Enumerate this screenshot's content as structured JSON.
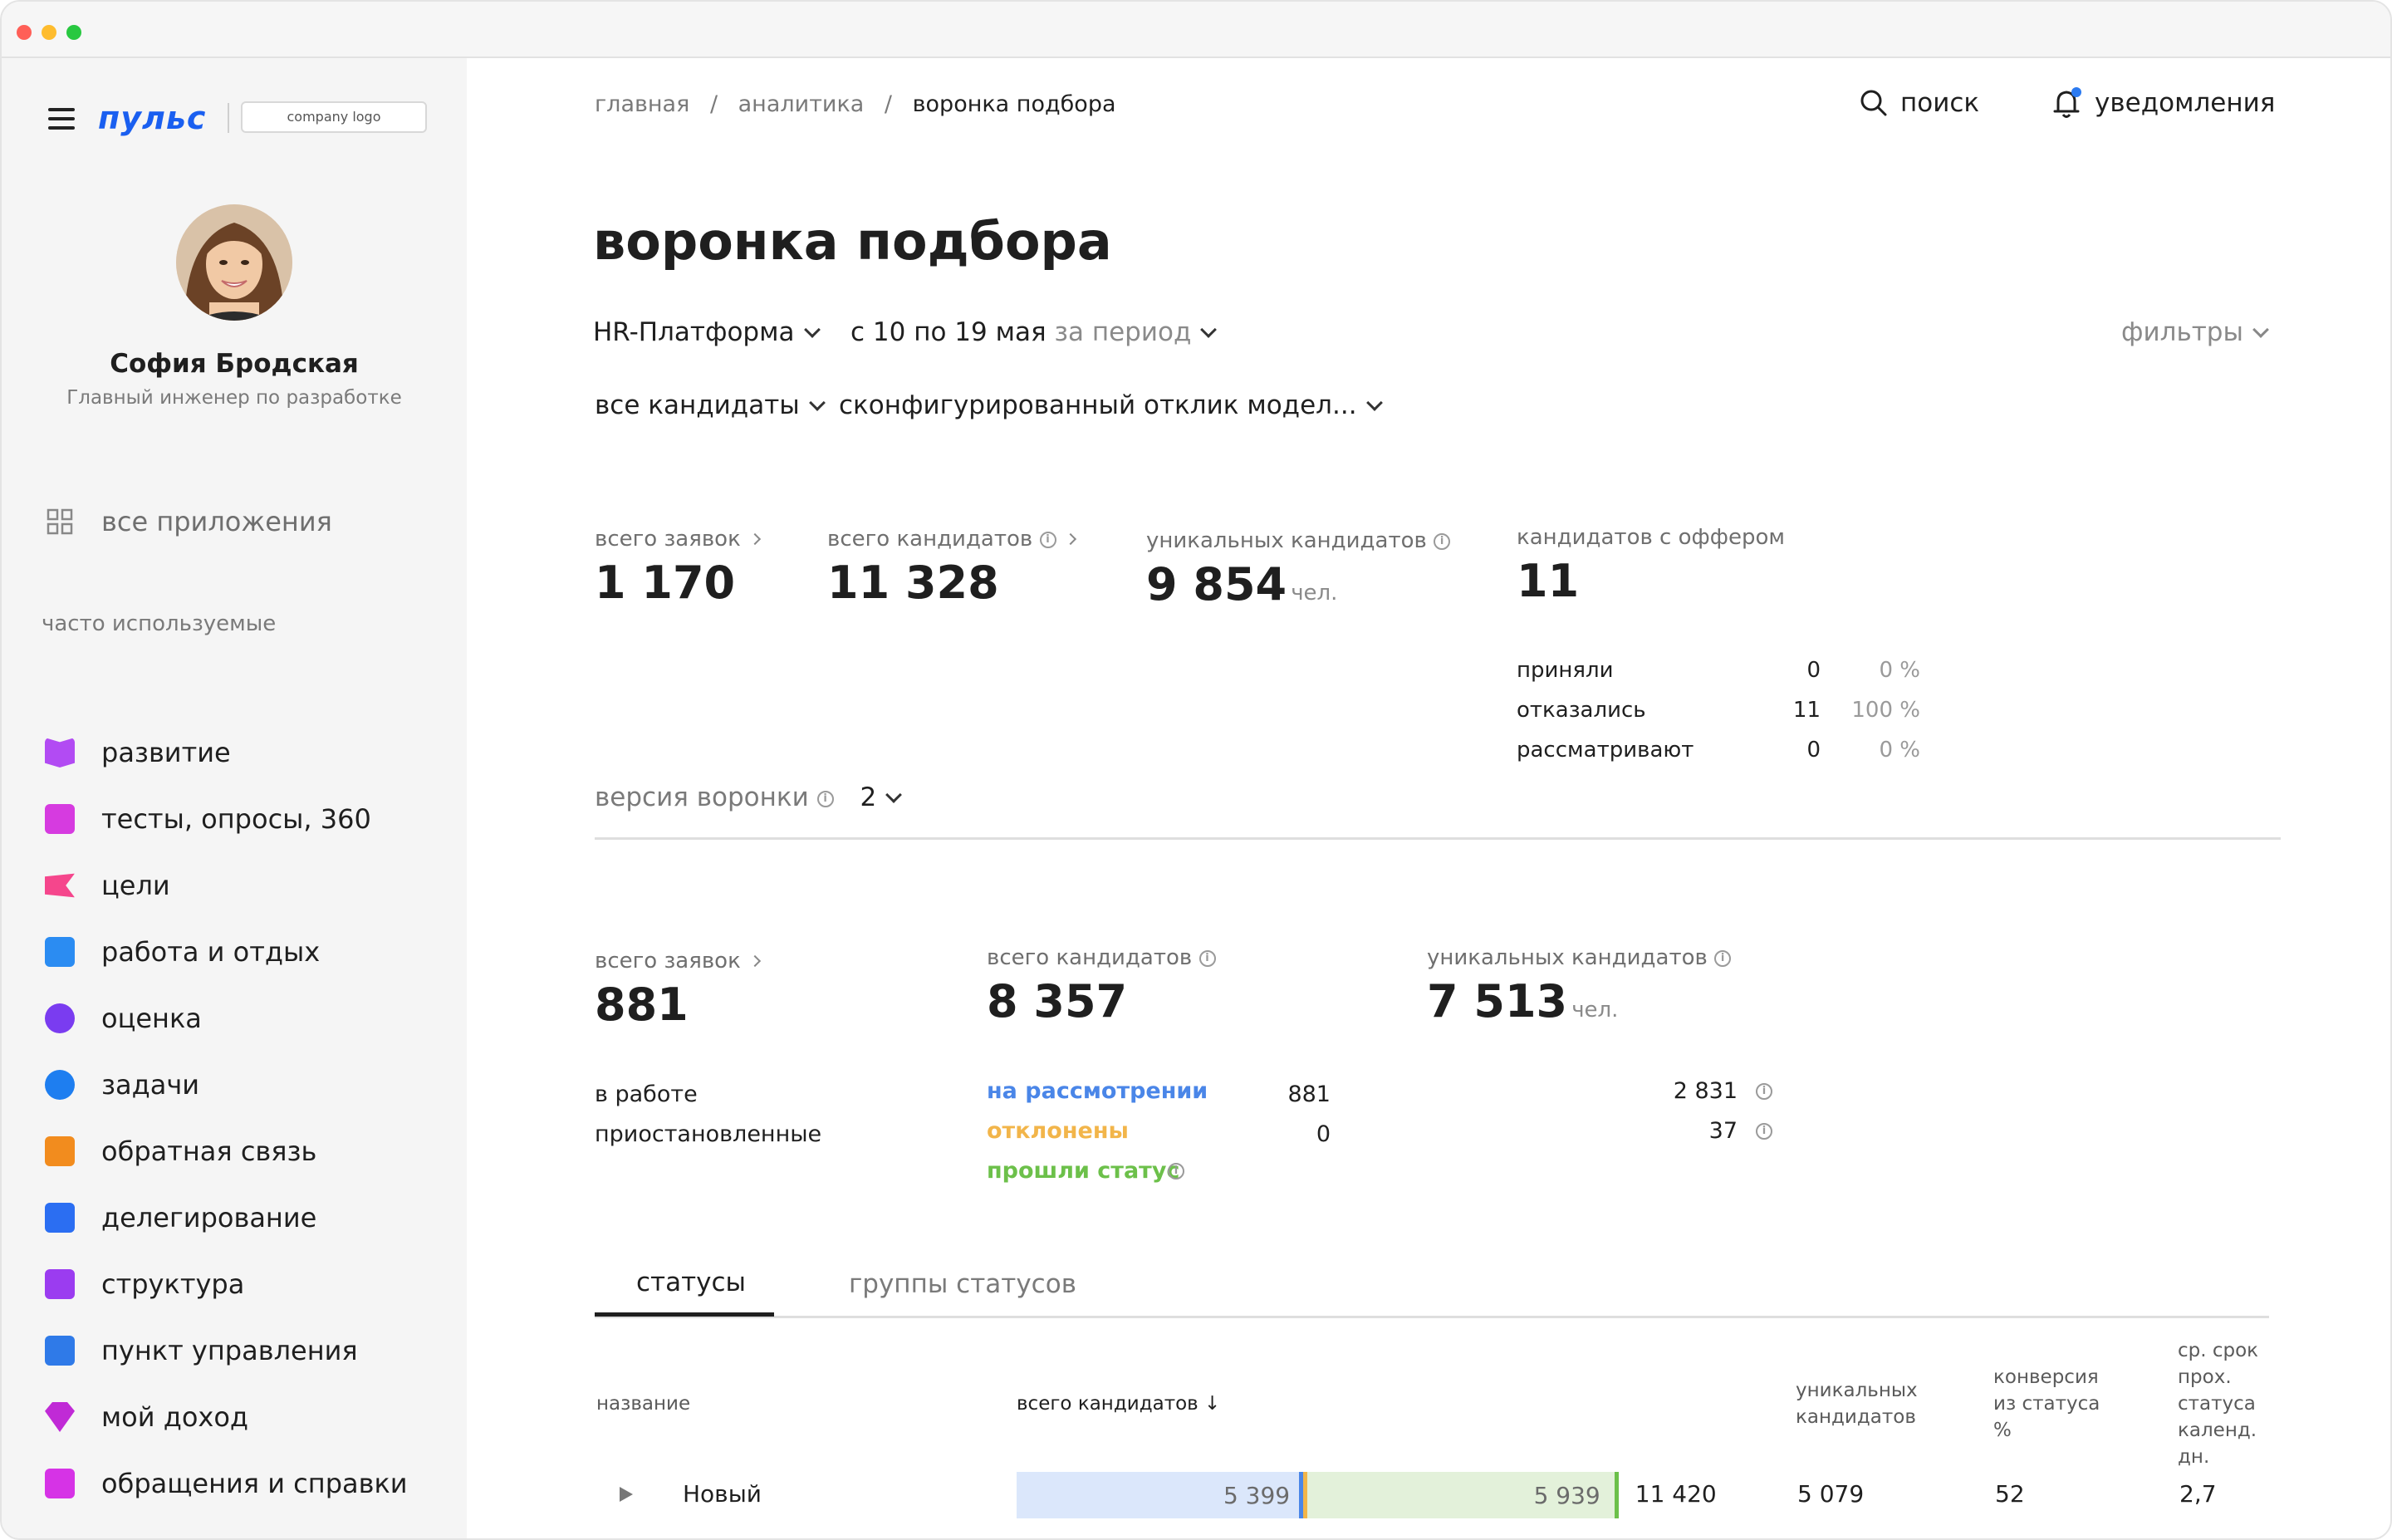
{
  "window": {
    "dots": [
      "#ff5f57",
      "#febc2e",
      "#28c840"
    ]
  },
  "sidebar": {
    "brand": "пульс",
    "company_logo": "company logo",
    "user": {
      "name": "София Бродская",
      "role": "Главный инженер по разработке"
    },
    "all_apps": "все приложения",
    "section_title": "часто используемые",
    "items": [
      {
        "label": "развитие",
        "icon": "book-icon",
        "color": "#b24bf3"
      },
      {
        "label": "тесты, опросы, 360",
        "icon": "checkbox-icon",
        "color": "#d63be0"
      },
      {
        "label": "цели",
        "icon": "flag-icon",
        "color": "#f5468c"
      },
      {
        "label": "работа и отдых",
        "icon": "weather-icon",
        "color": "#2b8cf2"
      },
      {
        "label": "оценка",
        "icon": "star-icon",
        "color": "#7a3cf0"
      },
      {
        "label": "задачи",
        "icon": "target-icon",
        "color": "#1e7ef0"
      },
      {
        "label": "обратная связь",
        "icon": "feedback-icon",
        "color": "#f28c1e"
      },
      {
        "label": "делегирование",
        "icon": "people-icon",
        "color": "#2b6ef2"
      },
      {
        "label": "структура",
        "icon": "structure-icon",
        "color": "#9b3cf0"
      },
      {
        "label": "пункт управления",
        "icon": "wrench-icon",
        "color": "#2f7ae8"
      },
      {
        "label": "мой доход",
        "icon": "gem-icon",
        "color": "#c02ad6"
      },
      {
        "label": "обращения и справки",
        "icon": "document-icon",
        "color": "#d633e6"
      }
    ]
  },
  "header": {
    "breadcrumb": [
      "главная",
      "аналитика",
      "воронка подбора"
    ],
    "search": "поиск",
    "notifications": "уведомления"
  },
  "page": {
    "title": "воронка подбора",
    "platform": "HR-Платформа",
    "period_prefix": "с 10 по 19 мая",
    "period_suffix": "за период",
    "filters": "фильтры",
    "candidates_filter": "все кандидаты",
    "response_filter": "сконфигурированный отклик модел..."
  },
  "summary": {
    "applications": {
      "label": "всего заявок",
      "value": "1 170"
    },
    "candidates": {
      "label": "всего кандидатов",
      "value": "11 328"
    },
    "unique": {
      "label": "уникальных кандидатов",
      "value": "9 854",
      "unit": "чел."
    },
    "offer": {
      "label": "кандидатов с оффером",
      "value": "11",
      "rows": [
        {
          "label": "приняли",
          "count": "0",
          "pct": "0 %"
        },
        {
          "label": "отказались",
          "count": "11",
          "pct": "100 %"
        },
        {
          "label": "рассматривают",
          "count": "0",
          "pct": "0 %"
        }
      ]
    }
  },
  "funnel": {
    "version_label": "версия воронки",
    "version_value": "2",
    "applications": {
      "label": "всего заявок",
      "value": "881",
      "rows": [
        {
          "label": "в работе",
          "value": "881"
        },
        {
          "label": "приостановленные",
          "value": "0"
        }
      ]
    },
    "candidates": {
      "label": "всего кандидатов",
      "value": "8 357",
      "rows": [
        {
          "label": "на рассмотрении",
          "value": "2 831",
          "color": "#4a86e8"
        },
        {
          "label": "отклонены",
          "value": "37",
          "color": "#f2b54a"
        },
        {
          "label": "прошли статус",
          "value": "",
          "color": "#6cc04a"
        }
      ]
    },
    "unique": {
      "label": "уникальных кандидатов",
      "value": "7 513",
      "unit": "чел."
    }
  },
  "tabs": [
    {
      "label": "статусы",
      "active": true
    },
    {
      "label": "группы статусов",
      "active": false
    }
  ],
  "table": {
    "headers": {
      "name": "название",
      "total": "всего кандидатов ↓",
      "unique": "уникальных кандидатов",
      "conversion": "конверсия из статуса %",
      "duration": "ср. срок прох. статуса календ. дн."
    },
    "rows": [
      {
        "name": "Новый",
        "bar_a": 5399,
        "bar_a_label": "5 399",
        "bar_b": 5939,
        "bar_b_label": "5 939",
        "total": "11 420",
        "unique": "5 079",
        "conversion": "52",
        "duration": "2,7"
      }
    ],
    "bar_max": 11420
  }
}
